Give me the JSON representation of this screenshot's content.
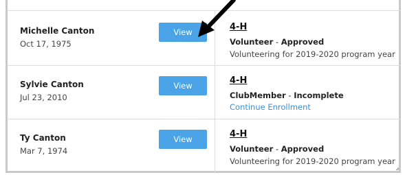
{
  "members": [
    {
      "name": "Michelle Canton",
      "dob": "Oct 17, 1975",
      "view_label": "View",
      "program": "4-H",
      "role": "Volunteer",
      "status_sep": " - ",
      "status": "Approved",
      "note": "Volunteering for 2019-2020 program year"
    },
    {
      "name": "Sylvie Canton",
      "dob": "Jul 23, 2010",
      "view_label": "View",
      "program": "4-H",
      "role": "ClubMember",
      "status_sep": " - ",
      "status": "Incomplete",
      "link": "Continue Enrollment"
    },
    {
      "name": "Ty Canton",
      "dob": "Mar 7, 1974",
      "view_label": "View",
      "program": "4-H",
      "role": "Volunteer",
      "status_sep": " - ",
      "status": "Approved",
      "note": "Volunteering for 2019-2020 program year"
    }
  ],
  "colors": {
    "button": "#4aa3e6",
    "link": "#3a8fd6",
    "divider": "#dcdcdc",
    "frame": "#c9c9c9"
  },
  "icons": [
    "pointer-arrow-icon",
    "resize-grip-icon"
  ]
}
